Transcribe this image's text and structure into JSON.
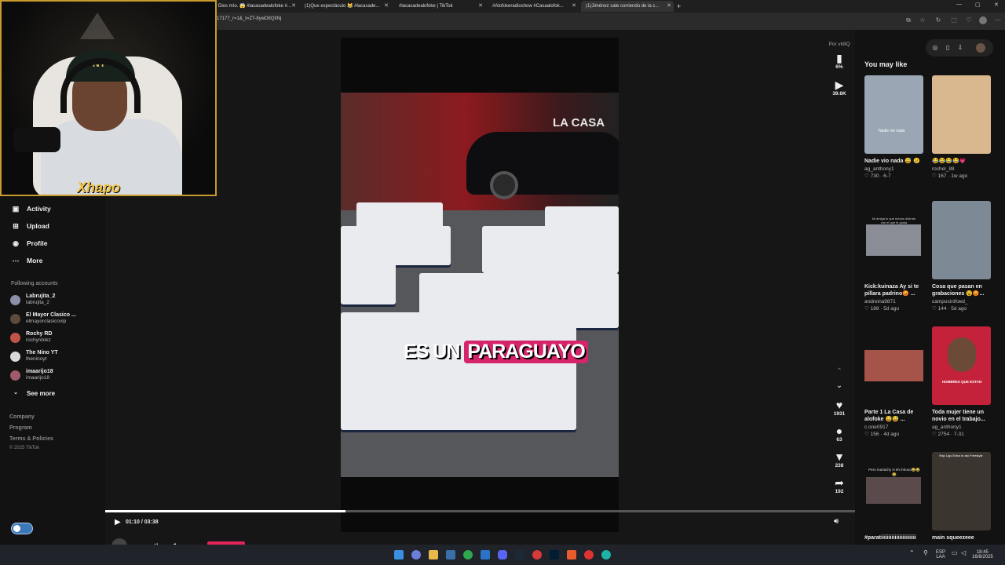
{
  "browser": {
    "tabs": [
      {
        "title": "Dios mío. 😱 #lacasadealofoke #..."
      },
      {
        "title": "(1)Que espectáculo 😹 #lacasade..."
      },
      {
        "title": "#lacasadealofoke | TikTok"
      },
      {
        "title": "#Alofokeradioshow #Casaalofok..."
      },
      {
        "title": "(1)Jiménez sale corriendo de la c..."
      }
    ],
    "new_tab": "+",
    "url": "17177_r=1&_t=ZT-8ywD8QIINj",
    "window_controls": [
      "—",
      "▢",
      "✕"
    ]
  },
  "webcam": {
    "overlay_text": "Xhapo",
    "cap_logo": "NY"
  },
  "sidebar": {
    "nav": [
      {
        "label": "Activity",
        "icon": "inbox-icon",
        "glyph": "▣"
      },
      {
        "label": "Upload",
        "icon": "upload-icon",
        "glyph": "⊞"
      },
      {
        "label": "Profile",
        "icon": "profile-icon",
        "glyph": "◉"
      },
      {
        "label": "More",
        "icon": "more-icon",
        "glyph": "⋯"
      }
    ],
    "following_header": "Following accounts",
    "accounts": [
      {
        "name": "Labrujita_2",
        "handle": "labrujita_2",
        "color": "#8b8fa8"
      },
      {
        "name": "El Mayor Clasico ...",
        "handle": "elmayorclasicovip",
        "color": "#5d4a3a"
      },
      {
        "name": "Rochy RD",
        "handle": "rochyrdokz",
        "color": "#c0544a"
      },
      {
        "name": "The Nino YT",
        "handle": "theninoyt",
        "color": "#d8d8d8"
      },
      {
        "name": "imaarijo18",
        "handle": "imaarijo18",
        "color": "#a05a6a"
      }
    ],
    "see_more": "See more",
    "footer": [
      "Company",
      "Program",
      "Terms & Policies",
      "© 2025 TikTok"
    ]
  },
  "video": {
    "caption_words": [
      "ES UN",
      "PARAGUAYO"
    ],
    "sign_text": "LA CASA",
    "current_time": "01:10",
    "duration": "03:38",
    "time_display": "01:10 / 03:38",
    "progress": 0.32,
    "author": "ag_anthony1"
  },
  "side_actions": {
    "top_label": "Por vidIQ",
    "stats_percent": "6%",
    "views": "39.6K",
    "likes": "1931",
    "comments": "63",
    "saves": "238",
    "shares": "192"
  },
  "right_panel": {
    "title": "You may like",
    "cards": [
      {
        "title": "Nadie vio nada 😅 😢",
        "user": "ag_anthony1",
        "meta": "♡ 730 · 6-7",
        "thumb_text": "Nadie vio nada",
        "bg": "#9aa6b3"
      },
      {
        "title": "😂😂😂😂💗",
        "user": "rochel_88",
        "meta": "♡ 167 · 1w ago",
        "thumb_text": "",
        "bg": "#d9b88f"
      },
      {
        "title": "Kick:kuinaza Ay si te pillara padrino😡 ...",
        "user": "andreina9871",
        "meta": "♡ 188 · 5d ago",
        "thumb_text": "Mi amiga lo que menos disfruto con el que le gusta",
        "bg": "#ffffff"
      },
      {
        "title": "Cosa que pasan en grabaciones 😵😡...",
        "user": "camposinifoed_",
        "meta": "♡ 144 · 5d ago",
        "thumb_text": "",
        "bg": "#7d8a96"
      },
      {
        "title": "Parte 1 La Casa de alofoke 😅😅 ...",
        "user": "c.one0917",
        "meta": "♡ 156 · 4d ago",
        "thumb_text": "",
        "bg": "#ffffff"
      },
      {
        "title": "Toda mujer tiene un novio en el trabajo...",
        "user": "ag_anthony1",
        "meta": "♡ 2754 · 7-31",
        "thumb_text": "HOMBRES QUE ESTAN",
        "bg": "#c4213a"
      },
      {
        "title": "#paratiiiiiiiiiiiiiiiiiiiiiii",
        "user": "",
        "meta": "",
        "thumb_text": "Pero mariachy si eh intruso😂😂😂",
        "bg": "#ffffff"
      },
      {
        "title": "main squeezeee",
        "user": "",
        "meta": "",
        "thumb_text": "Rap Ligo Extra In ato Freestyle",
        "bg": "#3b3530"
      }
    ]
  },
  "taskbar": {
    "tray": {
      "lang_1": "ESP",
      "lang_2": "LAA",
      "time": "18:45",
      "date": "16/8/2025"
    }
  },
  "colors": {
    "accent": "#e2245a",
    "caption_highlight": "#d6246a",
    "webcam_border": "#c79a2e"
  }
}
